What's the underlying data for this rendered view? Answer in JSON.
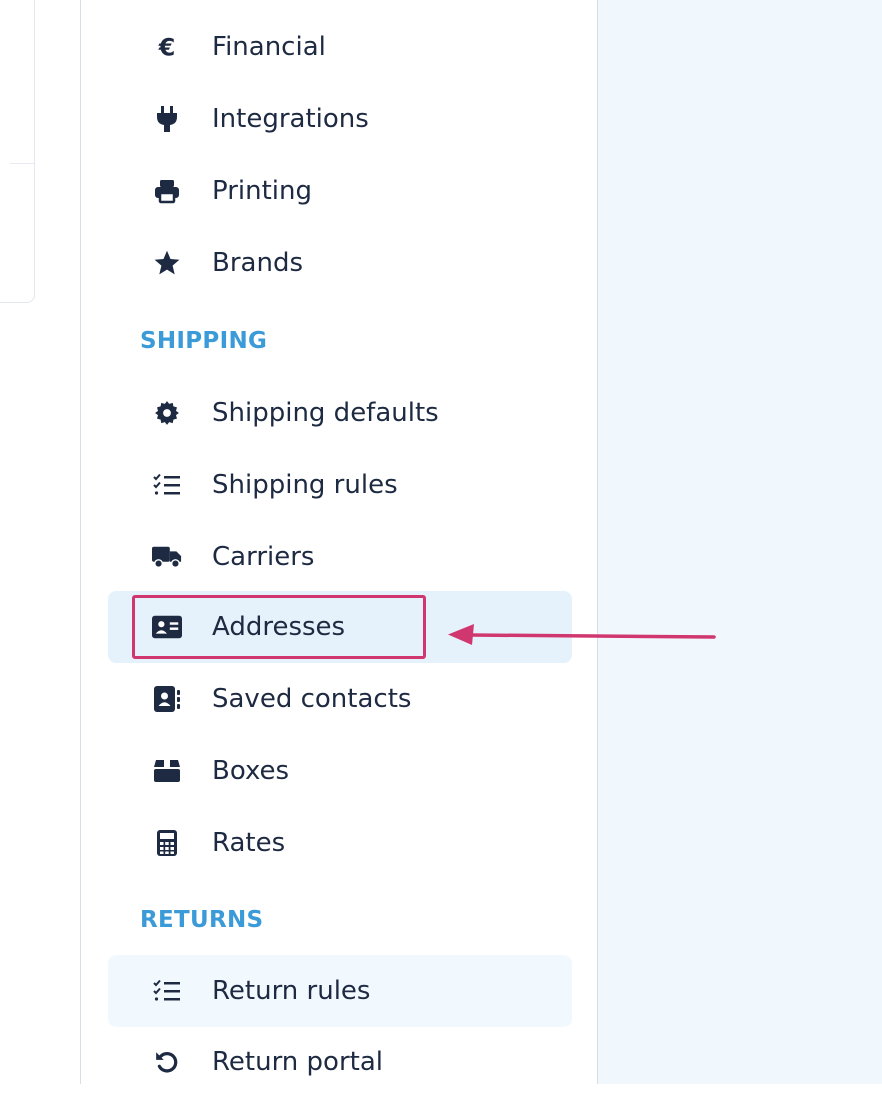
{
  "sidebar": {
    "items_top": [
      {
        "label": "Financial",
        "icon": "euro-icon"
      },
      {
        "label": "Integrations",
        "icon": "plug-icon"
      },
      {
        "label": "Printing",
        "icon": "printer-icon"
      },
      {
        "label": "Brands",
        "icon": "star-icon"
      }
    ],
    "shipping": {
      "heading": "SHIPPING",
      "items": [
        {
          "label": "Shipping defaults",
          "icon": "gear-icon"
        },
        {
          "label": "Shipping rules",
          "icon": "checklist-icon"
        },
        {
          "label": "Carriers",
          "icon": "truck-icon"
        },
        {
          "label": "Addresses",
          "icon": "address-card-icon",
          "active": true
        },
        {
          "label": "Saved contacts",
          "icon": "contact-book-icon"
        },
        {
          "label": "Boxes",
          "icon": "box-icon"
        },
        {
          "label": "Rates",
          "icon": "calculator-icon"
        }
      ]
    },
    "returns": {
      "heading": "RETURNS",
      "items": [
        {
          "label": "Return rules",
          "icon": "checklist-icon"
        },
        {
          "label": "Return portal",
          "icon": "undo-icon"
        }
      ]
    }
  },
  "colors": {
    "text": "#1d2a42",
    "section_heading": "#3b9bd8",
    "active_bg": "#e5f2fc",
    "annotation": "#d1376f",
    "right_panel_bg": "#f1f8fd"
  }
}
